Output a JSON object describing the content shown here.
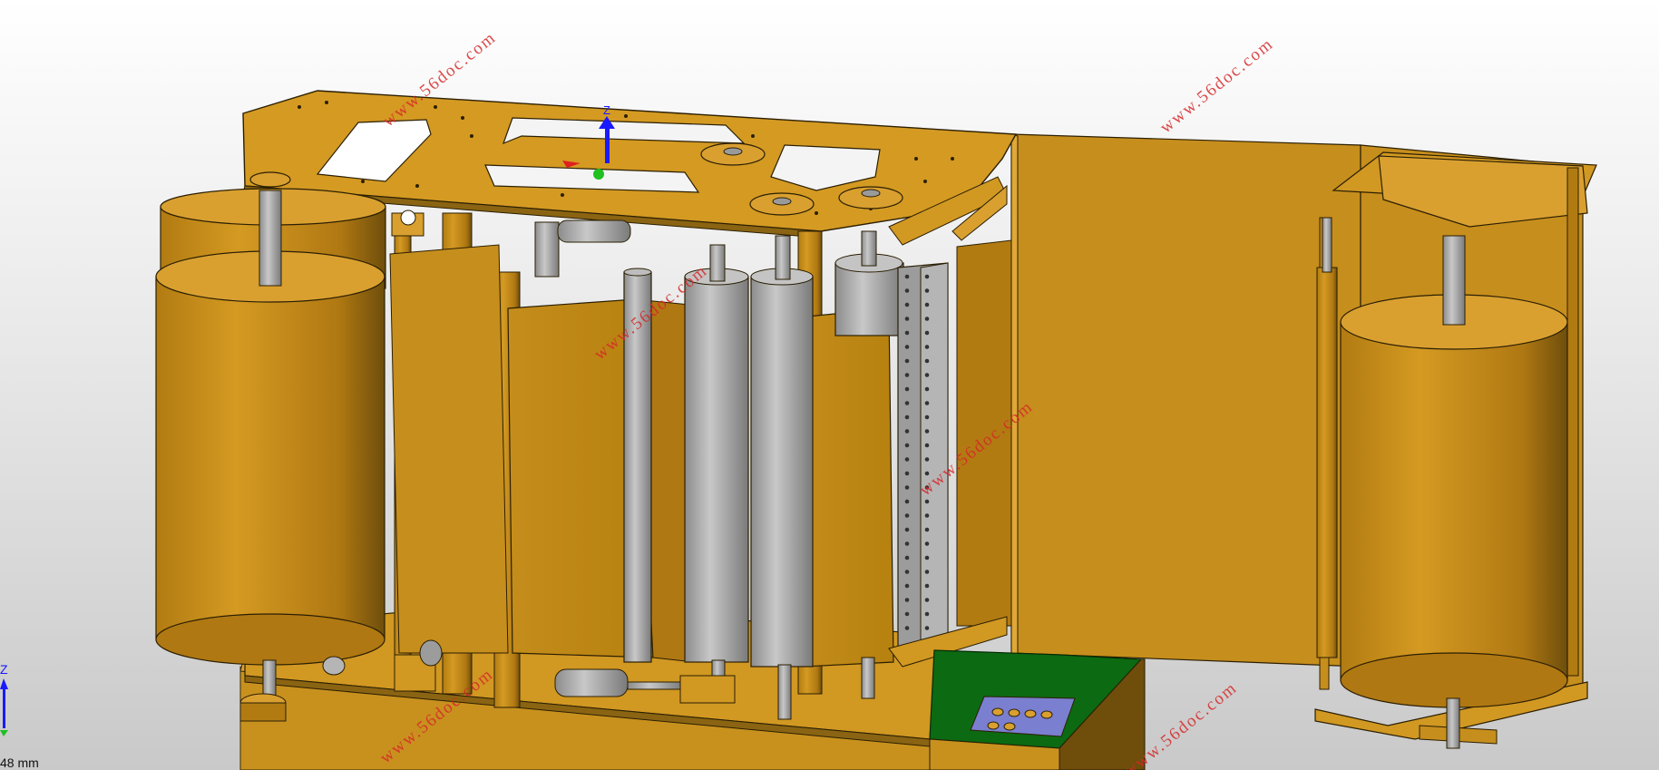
{
  "viewport": {
    "background_top": "#ffffff",
    "background_bottom": "#c9c9c9",
    "part_color": "#c8911e",
    "part_shadow": "#8a6412",
    "roller_color": "#a9a9a9",
    "pcb_color": "#0c6a12",
    "chip_color": "#7b7fd0"
  },
  "watermark": {
    "text": "www.56doc.com",
    "color": "#d62828"
  },
  "triad": {
    "z_label": "Z",
    "x_color": "#e02020",
    "y_color": "#20c020",
    "z_color": "#1a1aff"
  },
  "status": {
    "scale_text": "48 mm"
  }
}
